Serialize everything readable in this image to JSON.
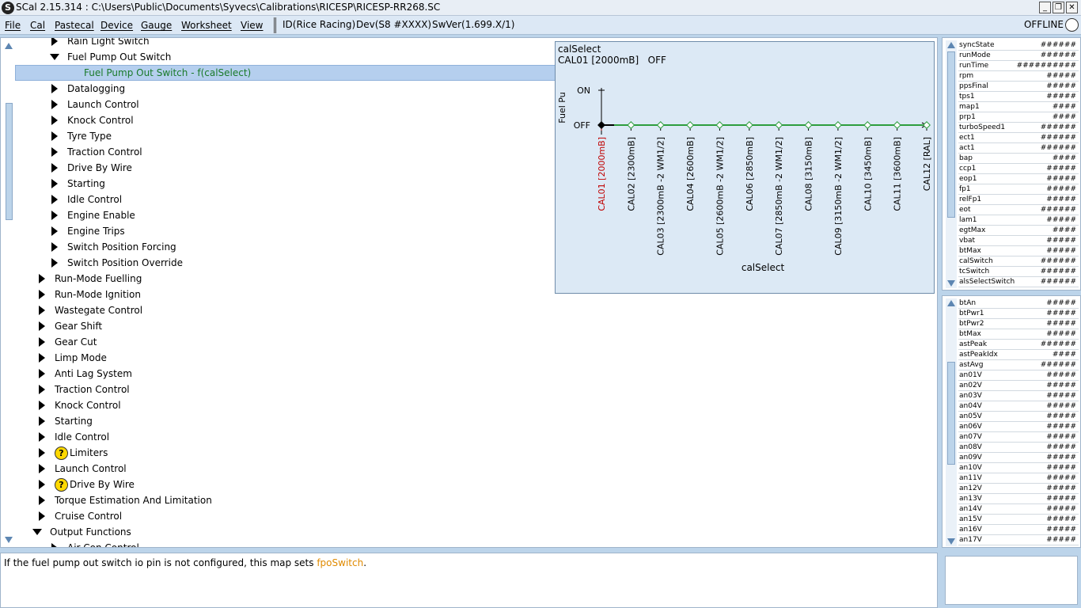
{
  "window": {
    "title": "SCal 2.15.314  :  C:\\Users\\Public\\Documents\\Syvecs\\Calibrations\\RICESP\\RICESP-RR268.SC",
    "app_icon": "S",
    "minimize": "_",
    "restore": "❐",
    "close": "✕"
  },
  "menu": {
    "items": [
      "File",
      "Cal",
      "Pastecal",
      "Device",
      "Gauge",
      "Worksheet",
      "View"
    ],
    "info": [
      "ID(Rice Racing)",
      "Dev(S8 #XXXX)",
      "SwVer(1.699.X/1)"
    ],
    "status": "OFFLINE"
  },
  "tree": {
    "items": [
      {
        "label": "Rain Light Switch",
        "level": 2,
        "state": "collapsed",
        "icon": null
      },
      {
        "label": "Fuel Pump Out Switch",
        "level": 2,
        "state": "expanded",
        "icon": null
      },
      {
        "label": "Fuel Pump Out Switch - f(calSelect)",
        "level": 3,
        "state": "leaf",
        "selected": true,
        "icon": null
      },
      {
        "label": "Datalogging",
        "level": 2,
        "state": "collapsed",
        "icon": null
      },
      {
        "label": "Launch Control",
        "level": 2,
        "state": "collapsed",
        "icon": null
      },
      {
        "label": "Knock Control",
        "level": 2,
        "state": "collapsed",
        "icon": null
      },
      {
        "label": "Tyre Type",
        "level": 2,
        "state": "collapsed",
        "icon": null
      },
      {
        "label": "Traction Control",
        "level": 2,
        "state": "collapsed",
        "icon": null
      },
      {
        "label": "Drive By Wire",
        "level": 2,
        "state": "collapsed",
        "icon": null
      },
      {
        "label": "Starting",
        "level": 2,
        "state": "collapsed",
        "icon": null
      },
      {
        "label": "Idle Control",
        "level": 2,
        "state": "collapsed",
        "icon": null
      },
      {
        "label": "Engine Enable",
        "level": 2,
        "state": "collapsed",
        "icon": null
      },
      {
        "label": "Engine Trips",
        "level": 2,
        "state": "collapsed",
        "icon": null
      },
      {
        "label": "Switch Position Forcing",
        "level": 2,
        "state": "collapsed",
        "icon": null
      },
      {
        "label": "Switch Position Override",
        "level": 2,
        "state": "collapsed",
        "icon": null
      },
      {
        "label": "Run-Mode Fuelling",
        "level": 1,
        "state": "collapsed",
        "icon": null
      },
      {
        "label": "Run-Mode Ignition",
        "level": 1,
        "state": "collapsed",
        "icon": null
      },
      {
        "label": "Wastegate Control",
        "level": 1,
        "state": "collapsed",
        "icon": null
      },
      {
        "label": "Gear Shift",
        "level": 1,
        "state": "collapsed",
        "icon": null
      },
      {
        "label": "Gear Cut",
        "level": 1,
        "state": "collapsed",
        "icon": null
      },
      {
        "label": "Limp Mode",
        "level": 1,
        "state": "collapsed",
        "icon": null
      },
      {
        "label": "Anti Lag System",
        "level": 1,
        "state": "collapsed",
        "icon": null
      },
      {
        "label": "Traction Control",
        "level": 1,
        "state": "collapsed",
        "icon": null
      },
      {
        "label": "Knock Control",
        "level": 1,
        "state": "collapsed",
        "icon": null
      },
      {
        "label": "Starting",
        "level": 1,
        "state": "collapsed",
        "icon": null
      },
      {
        "label": "Idle Control",
        "level": 1,
        "state": "collapsed",
        "icon": null
      },
      {
        "label": "Limiters",
        "level": 1,
        "state": "collapsed",
        "icon": "warning-icon"
      },
      {
        "label": "Launch Control",
        "level": 1,
        "state": "collapsed",
        "icon": null
      },
      {
        "label": "Drive By Wire",
        "level": 1,
        "state": "collapsed",
        "icon": "warning-icon"
      },
      {
        "label": "Torque Estimation And Limitation",
        "level": 1,
        "state": "collapsed",
        "icon": null
      },
      {
        "label": "Cruise Control",
        "level": 1,
        "state": "collapsed",
        "icon": null
      },
      {
        "label": "Output Functions",
        "level": 0,
        "state": "expanded",
        "icon": null
      },
      {
        "label": "Air Con Control",
        "level": 2,
        "state": "collapsed",
        "icon": null
      }
    ]
  },
  "graph": {
    "title": "calSelect",
    "value_label": "CAL01 [2000mB]",
    "value": "OFF",
    "ylabel": "Fuel Pu",
    "y_ticks": [
      "ON",
      "OFF"
    ],
    "xlabel": "calSelect",
    "x_ticks": [
      "CAL01 [2000mB]",
      "CAL02 [2300mB]",
      "CAL03 [2300mB -2 WM1/2]",
      "CAL04 [2600mB]",
      "CAL05 [2600mB -2 WM1/2]",
      "CAL06 [2850mB]",
      "CAL07 [2850mB -2 WM1/2]",
      "CAL08 [3150mB]",
      "CAL09 [3150mB -2 WM1/2]",
      "CAL10 [3450mB]",
      "CAL11 [3600mB]",
      "CAL12 [RAL]"
    ],
    "active_index": 0,
    "colors": {
      "line": "#2e9e3e",
      "active_tick": "#c00000",
      "axis": "#000000"
    }
  },
  "chart_data": {
    "type": "line",
    "title": "calSelect",
    "xlabel": "calSelect",
    "ylabel": "Fuel Pu",
    "categories": [
      "CAL01 [2000mB]",
      "CAL02 [2300mB]",
      "CAL03 [2300mB -2 WM1/2]",
      "CAL04 [2600mB]",
      "CAL05 [2600mB -2 WM1/2]",
      "CAL06 [2850mB]",
      "CAL07 [2850mB -2 WM1/2]",
      "CAL08 [3150mB]",
      "CAL09 [3150mB -2 WM1/2]",
      "CAL10 [3450mB]",
      "CAL11 [3600mB]",
      "CAL12 [RAL]"
    ],
    "y_categories": [
      "OFF",
      "ON"
    ],
    "series": [
      {
        "values": [
          "OFF",
          "OFF",
          "OFF",
          "OFF",
          "OFF",
          "OFF",
          "OFF",
          "OFF",
          "OFF",
          "OFF",
          "OFF",
          "OFF"
        ]
      }
    ]
  },
  "status_panel_1": {
    "rows": [
      {
        "name": "syncState",
        "value": "######"
      },
      {
        "name": "runMode",
        "value": "######"
      },
      {
        "name": "runTime",
        "value": "##########"
      },
      {
        "name": "rpm",
        "value": "#####"
      },
      {
        "name": "ppsFinal",
        "value": "#####"
      },
      {
        "name": "tps1",
        "value": "#####"
      },
      {
        "name": "map1",
        "value": "####"
      },
      {
        "name": "prp1",
        "value": "####"
      },
      {
        "name": "turboSpeed1",
        "value": "######"
      },
      {
        "name": "ect1",
        "value": "######"
      },
      {
        "name": "act1",
        "value": "######"
      },
      {
        "name": "bap",
        "value": "####"
      },
      {
        "name": "ccp1",
        "value": "#####"
      },
      {
        "name": "eop1",
        "value": "#####"
      },
      {
        "name": "fp1",
        "value": "#####"
      },
      {
        "name": "relFp1",
        "value": "#####"
      },
      {
        "name": "eot",
        "value": "######"
      },
      {
        "name": "lam1",
        "value": "#####"
      },
      {
        "name": "egtMax",
        "value": "####"
      },
      {
        "name": "vbat",
        "value": "#####"
      },
      {
        "name": "btMax",
        "value": "#####"
      },
      {
        "name": "calSwitch",
        "value": "######"
      },
      {
        "name": "tcSwitch",
        "value": "######"
      },
      {
        "name": "alsSelectSwitch",
        "value": "######"
      }
    ]
  },
  "status_panel_2": {
    "rows": [
      {
        "name": "btAn",
        "value": "#####"
      },
      {
        "name": "btPwr1",
        "value": "#####"
      },
      {
        "name": "btPwr2",
        "value": "#####"
      },
      {
        "name": "btMax",
        "value": "#####"
      },
      {
        "name": "astPeak",
        "value": "######"
      },
      {
        "name": "astPeakIdx",
        "value": "####"
      },
      {
        "name": "astAvg",
        "value": "######"
      },
      {
        "name": "an01V",
        "value": "#####"
      },
      {
        "name": "an02V",
        "value": "#####"
      },
      {
        "name": "an03V",
        "value": "#####"
      },
      {
        "name": "an04V",
        "value": "#####"
      },
      {
        "name": "an05V",
        "value": "#####"
      },
      {
        "name": "an06V",
        "value": "#####"
      },
      {
        "name": "an07V",
        "value": "#####"
      },
      {
        "name": "an08V",
        "value": "#####"
      },
      {
        "name": "an09V",
        "value": "#####"
      },
      {
        "name": "an10V",
        "value": "#####"
      },
      {
        "name": "an11V",
        "value": "#####"
      },
      {
        "name": "an12V",
        "value": "#####"
      },
      {
        "name": "an13V",
        "value": "#####"
      },
      {
        "name": "an14V",
        "value": "#####"
      },
      {
        "name": "an15V",
        "value": "#####"
      },
      {
        "name": "an16V",
        "value": "#####"
      },
      {
        "name": "an17V",
        "value": "#####"
      }
    ]
  },
  "description": {
    "text": "If the fuel pump out switch io pin is not configured, this map sets ",
    "link": "fpoSwitch",
    "suffix": "."
  }
}
